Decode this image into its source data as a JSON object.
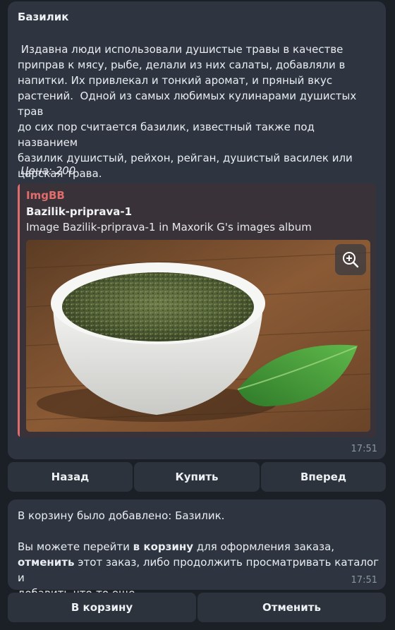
{
  "message1": {
    "title": "Базилик",
    "description": " Издавна люди использовали душистые травы в качестве\nприправ к мясу, рыбе, делали из них салаты, добавляли в\nнапитки. Их привлекал и тонкий аромат, и пряный вкус\nрастений.  Одной из самых любимых кулинарами душистых трав\nдо сих пор считается базилик, известный также под названием\nбазилик душистый, рейхон, рейган, душистый василек или\nцарская трава.",
    "price": "Цена: 200",
    "link_preview": {
      "site_name": "ImgBB",
      "title": "Bazilik-priprava-1",
      "description": "Image Bazilik-priprava-1 in Maxorik G's images album",
      "accent_color": "#e06c6c",
      "zoom_icon": "zoom-in-icon"
    },
    "time": "17:51"
  },
  "keyboard1": {
    "back": "Назад",
    "buy": "Купить",
    "forward": "Вперед"
  },
  "message2": {
    "line1": "В корзину было добавлено: Базилик.",
    "p_part1": "Вы можете перейти ",
    "p_bold1": "в корзину",
    "p_part2": " для оформления заказа,",
    "p_bold2": "отменить",
    "p_part3": " этот заказ, либо продолжить просматривать каталог и",
    "p_part4": "добавить что-то еще.",
    "time": "17:51"
  },
  "keyboard2": {
    "to_cart": "В корзину",
    "cancel": "Отменить"
  },
  "theme": {
    "background": "#1b1f26",
    "bubble": "#2e3540",
    "button": "#2c333d",
    "time_color": "#8b96a3"
  }
}
